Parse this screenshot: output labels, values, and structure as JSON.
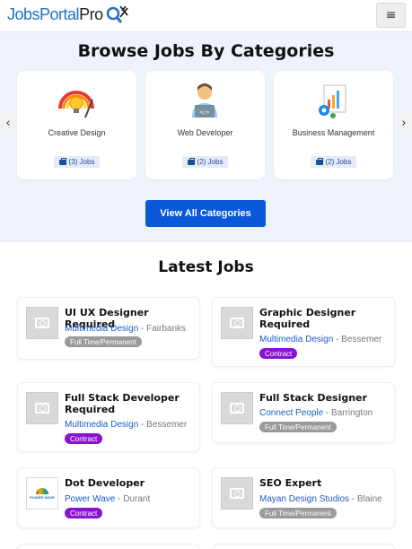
{
  "header": {
    "logo_jobs": "Jobs",
    "logo_portal": "Portal",
    "logo_pro": "Pro",
    "menu_icon": "≡"
  },
  "categories": {
    "title": "Browse Jobs By Categories",
    "prev_icon": "‹",
    "next_icon": "›",
    "items": [
      {
        "name": "Creative Design",
        "count": "(3) Jobs",
        "icon": "creative-design-icon"
      },
      {
        "name": "Web Developer",
        "count": "(2) Jobs",
        "icon": "web-developer-icon"
      },
      {
        "name": "Business Management",
        "count": "(2) Jobs",
        "icon": "business-management-icon"
      }
    ],
    "view_all_label": "View All Categories"
  },
  "latest": {
    "title": "Latest Jobs",
    "jobs": [
      {
        "title": "UI UX Designer Required",
        "company": "Multimedia Design",
        "location": " - Fairbanks",
        "type": "Full Time/Permanent"
      },
      {
        "title": "Graphic Designer Required",
        "company": "Multimedia Design",
        "location": " - Bessemer",
        "type": "Contract"
      },
      {
        "title": "Full Stack Developer Required",
        "company": "Multimedia Design",
        "location": " - Bessemer",
        "type": "Contract"
      },
      {
        "title": "Full Stack Designer",
        "company": "Connect People",
        "location": " - Barrington",
        "type": "Full Time/Permanent"
      },
      {
        "title": "Dot Developer",
        "company": "Power Wave",
        "location": " - Durant",
        "type": "Contract",
        "logo_text": "POWER WAVE"
      },
      {
        "title": "SEO Expert",
        "company": "Mayan Design Studios",
        "location": " - Blaine",
        "type": "Full Time/Permanent"
      }
    ]
  },
  "colors": {
    "primary_blue": "#0a58d8",
    "link_blue": "#1a5dc9",
    "contract_purple": "#8a12d6",
    "fulltime_gray": "#9a9a9a",
    "section_bg": "#eef2fb"
  }
}
